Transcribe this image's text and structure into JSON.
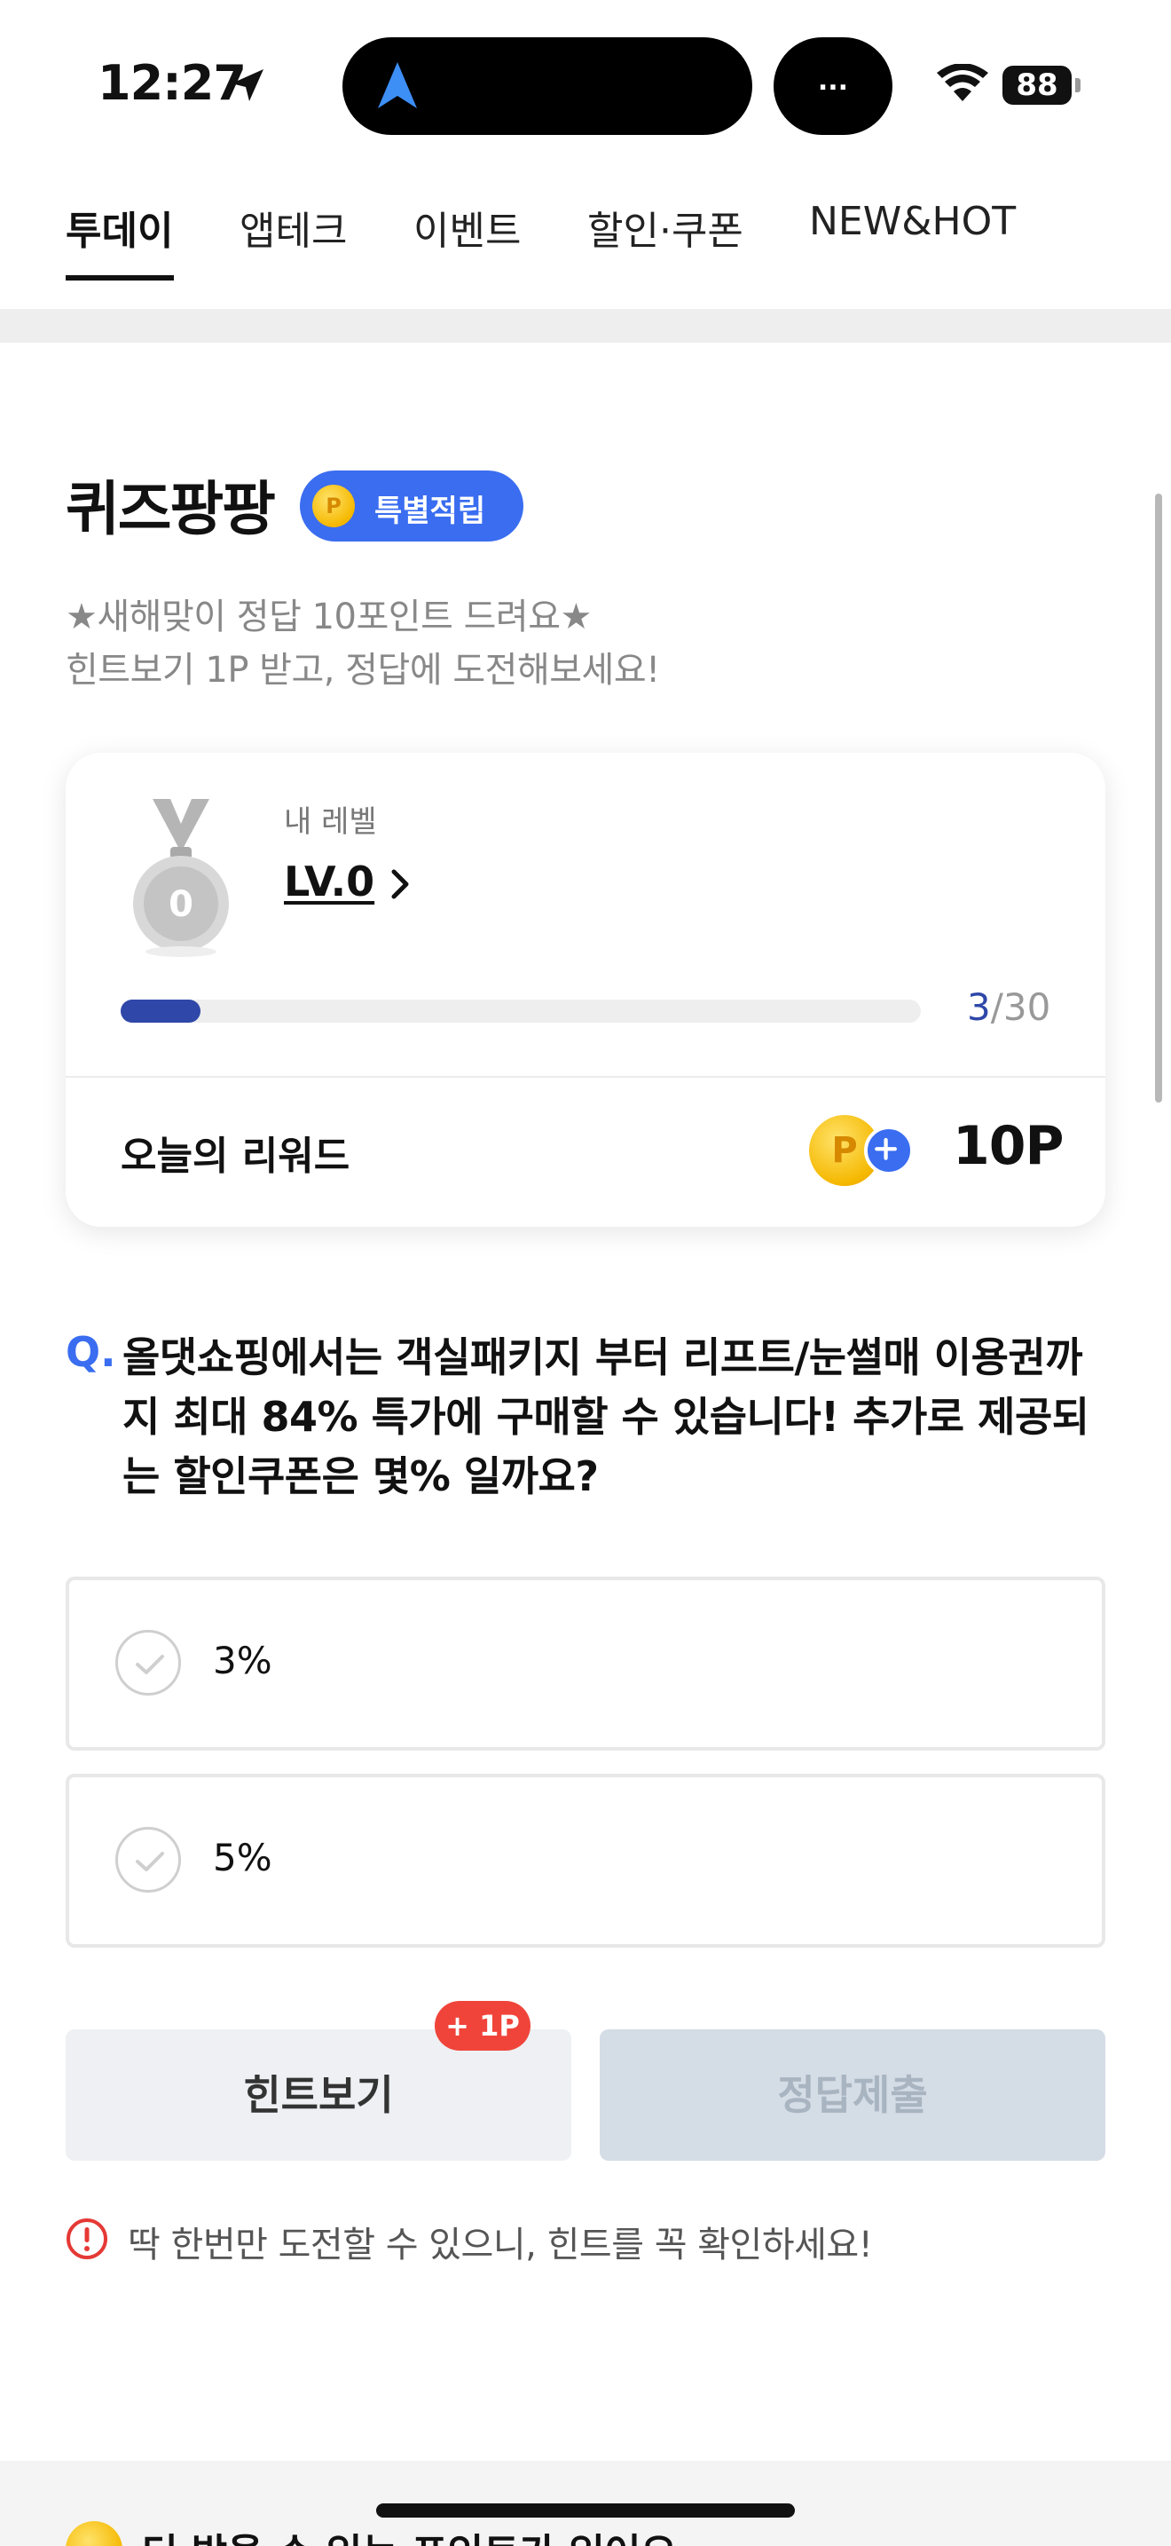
{
  "status_bar": {
    "time": "12:27",
    "island_indicator": "...",
    "battery": "88"
  },
  "tabs": [
    {
      "label": "투데이",
      "active": true
    },
    {
      "label": "앱테크",
      "active": false
    },
    {
      "label": "이벤트",
      "active": false
    },
    {
      "label": "할인·쿠폰",
      "active": false
    },
    {
      "label": "NEW&HOT",
      "active": false
    }
  ],
  "quiz": {
    "title": "퀴즈팡팡",
    "badge": "특별적립",
    "coin_glyph": "P",
    "description_line1": "★새해맞이 정답 10포인트 드려요★",
    "description_line2": "힌트보기 1P 받고, 정답에 도전해보세요!"
  },
  "level_card": {
    "level_label": "내 레벨",
    "level_value": "LV.0",
    "medal_number": "0",
    "progress_current": "3",
    "progress_total": "/30",
    "progress_fraction": 0.1,
    "reward_label": "오늘의 리워드",
    "reward_value": "10P"
  },
  "question": {
    "prefix": "Q.",
    "text": "올댓쇼핑에서는 객실패키지 부터 리프트/눈썰매 이용권까지 최대 84% 특가에 구매할 수 있습니다! 추가로 제공되는 할인쿠폰은 몇% 일까요?"
  },
  "options": [
    {
      "label": "3%"
    },
    {
      "label": "5%"
    }
  ],
  "buttons": {
    "hint": "힌트보기",
    "hint_badge": "+ 1P",
    "submit": "정답제출"
  },
  "notice": "딱 한번만 도전할 수 있으니, 힌트를 꼭 확인하세요!",
  "bottom_peek": "더 받을 수 있는 포인트가 있어요",
  "colors": {
    "accent": "#3a6df0",
    "progress": "#2e47a8",
    "hint_badge": "#f0443a",
    "notice": "#e53935"
  }
}
